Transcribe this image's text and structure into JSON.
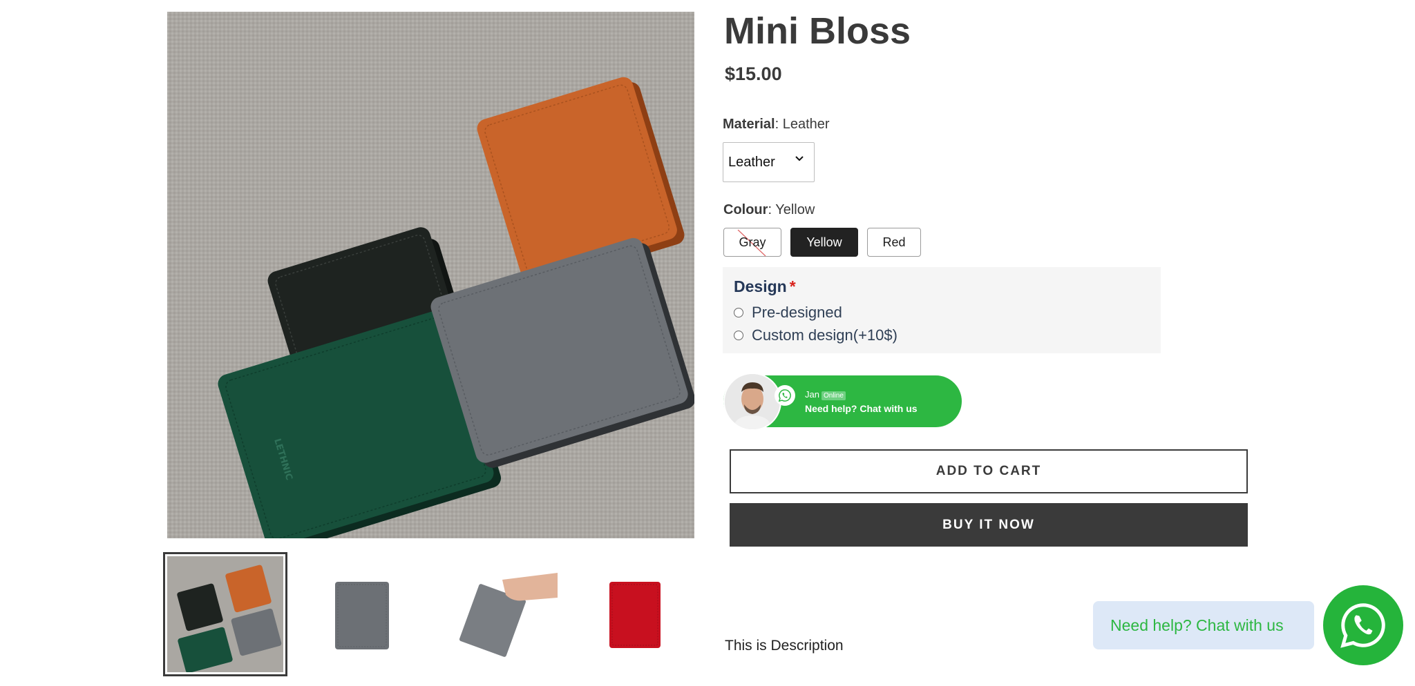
{
  "product": {
    "title": "Mini Bloss",
    "price": "$15.00",
    "description": "This is Description"
  },
  "material": {
    "label": "Material",
    "current": "Leather",
    "select_value": "Leather"
  },
  "colour": {
    "label": "Colour",
    "current": "Yellow",
    "options": [
      {
        "label": "Gray",
        "state": "unavailable"
      },
      {
        "label": "Yellow",
        "state": "selected"
      },
      {
        "label": "Red",
        "state": "available"
      }
    ]
  },
  "design": {
    "title": "Design",
    "required_mark": "*",
    "options": [
      "Pre-designed",
      "Custom design(+10$)"
    ]
  },
  "chat_pill": {
    "agent_name": "Jan",
    "status_badge": "Online",
    "cta": "Need help? Chat with us"
  },
  "buttons": {
    "add_to_cart": "ADD TO CART",
    "buy_now": "BUY IT NOW"
  },
  "floating_chat": {
    "bubble_text": "Need help? Chat with us"
  },
  "gallery": {
    "thumbnails": [
      {
        "name": "four-wallets",
        "selected": true
      },
      {
        "name": "gray-wallet",
        "selected": false
      },
      {
        "name": "gray-wallet-hand",
        "selected": false
      },
      {
        "name": "red-wallet",
        "selected": false
      }
    ],
    "wallet_brand_mark": "LETHNIC"
  },
  "colors": {
    "accent_green": "#2db742",
    "dark": "#3a3a3a",
    "required_red": "#d9221c"
  }
}
